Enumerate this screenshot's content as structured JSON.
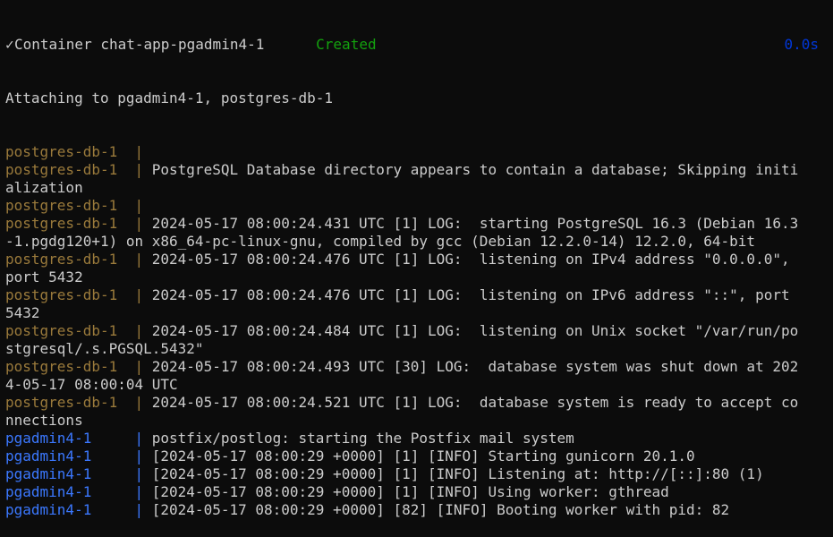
{
  "header": {
    "check_glyph": "✓",
    "container_text": "Container chat-app-pgadmin4-1",
    "status": "Created",
    "duration": "0.0s"
  },
  "attaching": "Attaching to pgadmin4-1, postgres-db-1",
  "colors": {
    "background": "#0c0c0c",
    "text": "#cccccc",
    "status_created": "#13a10e",
    "duration": "#0037da",
    "postgres_prefix": "#9a7a3b",
    "pgadmin_prefix": "#3b78ff"
  },
  "log_lines": [
    {
      "service": "postgres-db-1",
      "sep": "  |",
      "msg": ""
    },
    {
      "service": "postgres-db-1",
      "sep": "  | ",
      "msg": "PostgreSQL Database directory appears to contain a database; Skipping initi"
    },
    {
      "service": "",
      "sep": "",
      "msg": "alization"
    },
    {
      "service": "postgres-db-1",
      "sep": "  |",
      "msg": ""
    },
    {
      "service": "postgres-db-1",
      "sep": "  | ",
      "msg": "2024-05-17 08:00:24.431 UTC [1] LOG:  starting PostgreSQL 16.3 (Debian 16.3"
    },
    {
      "service": "",
      "sep": "",
      "msg": "-1.pgdg120+1) on x86_64-pc-linux-gnu, compiled by gcc (Debian 12.2.0-14) 12.2.0, 64-bit"
    },
    {
      "service": "postgres-db-1",
      "sep": "  | ",
      "msg": "2024-05-17 08:00:24.476 UTC [1] LOG:  listening on IPv4 address \"0.0.0.0\","
    },
    {
      "service": "",
      "sep": "",
      "msg": "port 5432"
    },
    {
      "service": "postgres-db-1",
      "sep": "  | ",
      "msg": "2024-05-17 08:00:24.476 UTC [1] LOG:  listening on IPv6 address \"::\", port"
    },
    {
      "service": "",
      "sep": "",
      "msg": "5432"
    },
    {
      "service": "postgres-db-1",
      "sep": "  | ",
      "msg": "2024-05-17 08:00:24.484 UTC [1] LOG:  listening on Unix socket \"/var/run/po"
    },
    {
      "service": "",
      "sep": "",
      "msg": "stgresql/.s.PGSQL.5432\""
    },
    {
      "service": "postgres-db-1",
      "sep": "  | ",
      "msg": "2024-05-17 08:00:24.493 UTC [30] LOG:  database system was shut down at 202"
    },
    {
      "service": "",
      "sep": "",
      "msg": "4-05-17 08:00:04 UTC"
    },
    {
      "service": "postgres-db-1",
      "sep": "  | ",
      "msg": "2024-05-17 08:00:24.521 UTC [1] LOG:  database system is ready to accept co"
    },
    {
      "service": "",
      "sep": "",
      "msg": "nnections"
    },
    {
      "service": "pgadmin4-1",
      "sep": "     | ",
      "msg": "postfix/postlog: starting the Postfix mail system"
    },
    {
      "service": "pgadmin4-1",
      "sep": "     | ",
      "msg": "[2024-05-17 08:00:29 +0000] [1] [INFO] Starting gunicorn 20.1.0"
    },
    {
      "service": "pgadmin4-1",
      "sep": "     | ",
      "msg": "[2024-05-17 08:00:29 +0000] [1] [INFO] Listening at: http://[::]:80 (1)"
    },
    {
      "service": "pgadmin4-1",
      "sep": "     | ",
      "msg": "[2024-05-17 08:00:29 +0000] [1] [INFO] Using worker: gthread"
    },
    {
      "service": "pgadmin4-1",
      "sep": "     | ",
      "msg": "[2024-05-17 08:00:29 +0000] [82] [INFO] Booting worker with pid: 82"
    }
  ]
}
